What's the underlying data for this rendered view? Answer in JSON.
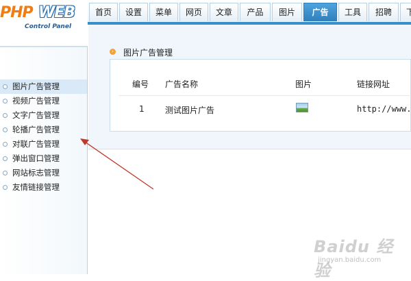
{
  "logo": {
    "brand_part1": "PHP",
    "brand_part2": "WEB",
    "subtitle": "Control Panel"
  },
  "tabs": [
    {
      "label": "首页",
      "active": false
    },
    {
      "label": "设置",
      "active": false
    },
    {
      "label": "菜单",
      "active": false
    },
    {
      "label": "网页",
      "active": false
    },
    {
      "label": "文章",
      "active": false
    },
    {
      "label": "产品",
      "active": false
    },
    {
      "label": "图片",
      "active": false
    },
    {
      "label": "广告",
      "active": true
    },
    {
      "label": "工具",
      "active": false
    },
    {
      "label": "招聘",
      "active": false
    },
    {
      "label": "下",
      "active": false
    }
  ],
  "sidebar": {
    "items": [
      {
        "label": "图片广告管理",
        "active": true
      },
      {
        "label": "视频广告管理",
        "active": false
      },
      {
        "label": "文字广告管理",
        "active": false
      },
      {
        "label": "轮播广告管理",
        "active": false
      },
      {
        "label": "对联广告管理",
        "active": false
      },
      {
        "label": "弹出窗口管理",
        "active": false
      },
      {
        "label": "网站标志管理",
        "active": false
      },
      {
        "label": "友情链接管理",
        "active": false
      }
    ]
  },
  "main": {
    "section_title": "图片广告管理",
    "table": {
      "headers": [
        "编号",
        "广告名称",
        "图片",
        "链接网址"
      ],
      "rows": [
        {
          "id": "1",
          "name": "测试图片广告",
          "image": "image-icon",
          "url": "http://www."
        }
      ]
    }
  },
  "watermark": {
    "main": "Baidu 经验",
    "sub": "jingyan.baidu.com"
  },
  "colors": {
    "tab_active": "#3b8fc9",
    "arrow": "#c0392b",
    "logo_orange": "#f07c12",
    "logo_blue": "#2a6aa8"
  }
}
